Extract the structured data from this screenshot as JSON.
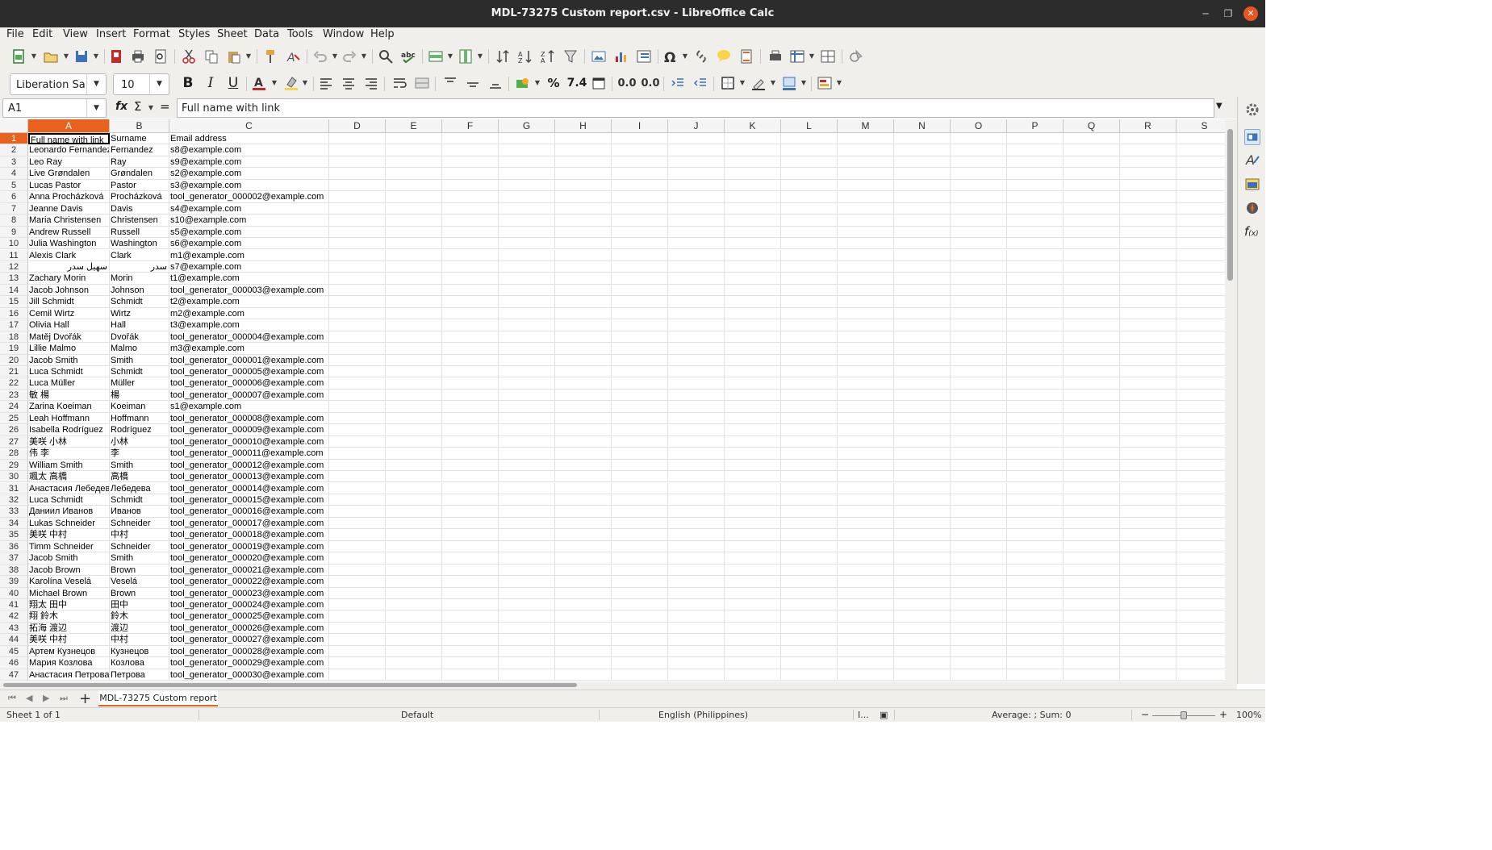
{
  "window": {
    "title": "MDL-73275 Custom report.csv - LibreOffice Calc"
  },
  "menu": [
    "File",
    "Edit",
    "View",
    "Insert",
    "Format",
    "Styles",
    "Sheet",
    "Data",
    "Tools",
    "Window",
    "Help"
  ],
  "toolbar": {
    "font_name": "Liberation Sa",
    "font_size": "10",
    "percent": "%",
    "number_format": "7.4",
    "add_decimal": "0.0",
    "del_decimal": "0.0"
  },
  "formula": {
    "name_box": "A1",
    "fx": "fx",
    "sigma": "Σ",
    "equals": "=",
    "content": "Full name with link"
  },
  "columns": [
    "A",
    "B",
    "C",
    "D",
    "E",
    "F",
    "G",
    "H",
    "I",
    "J",
    "K",
    "L",
    "M",
    "N",
    "O",
    "P",
    "Q",
    "R",
    "S"
  ],
  "rows": [
    [
      "1",
      "Full name with link",
      "Surname",
      "Email address"
    ],
    [
      "2",
      "Leonardo Fernandez",
      "Fernandez",
      "s8@example.com"
    ],
    [
      "3",
      "Leo Ray",
      "Ray",
      "s9@example.com"
    ],
    [
      "4",
      "Live Grøndalen",
      "Grøndalen",
      "s2@example.com"
    ],
    [
      "5",
      "Lucas Pastor",
      "Pastor",
      "s3@example.com"
    ],
    [
      "6",
      "Anna Procházková",
      "Procházková",
      "tool_generator_000002@example.com"
    ],
    [
      "7",
      "Jeanne Davis",
      "Davis",
      "s4@example.com"
    ],
    [
      "8",
      "Maria Christensen",
      "Christensen",
      "s10@example.com"
    ],
    [
      "9",
      "Andrew Russell",
      "Russell",
      "s5@example.com"
    ],
    [
      "10",
      "Julia Washington",
      "Washington",
      "s6@example.com"
    ],
    [
      "11",
      "Alexis Clark",
      "Clark",
      "m1@example.com"
    ],
    [
      "12",
      "سهیل سدر",
      "سدر",
      "s7@example.com"
    ],
    [
      "13",
      "Zachary Morin",
      "Morin",
      "t1@example.com"
    ],
    [
      "14",
      "Jacob Johnson",
      "Johnson",
      "tool_generator_000003@example.com"
    ],
    [
      "15",
      "Jill Schmidt",
      "Schmidt",
      "t2@example.com"
    ],
    [
      "16",
      "Cemil Wirtz",
      "Wirtz",
      "m2@example.com"
    ],
    [
      "17",
      "Olivia Hall",
      "Hall",
      "t3@example.com"
    ],
    [
      "18",
      "Matěj Dvořák",
      "Dvořák",
      "tool_generator_000004@example.com"
    ],
    [
      "19",
      "Lillie Malmo",
      "Malmo",
      "m3@example.com"
    ],
    [
      "20",
      "Jacob Smith",
      "Smith",
      "tool_generator_000001@example.com"
    ],
    [
      "21",
      "Luca Schmidt",
      "Schmidt",
      "tool_generator_000005@example.com"
    ],
    [
      "22",
      "Luca Müller",
      "Müller",
      "tool_generator_000006@example.com"
    ],
    [
      "23",
      "敏 楊",
      "楊",
      "tool_generator_000007@example.com"
    ],
    [
      "24",
      "Zarina Koeiman",
      "Koeiman",
      "s1@example.com"
    ],
    [
      "25",
      "Leah Hoffmann",
      "Hoffmann",
      "tool_generator_000008@example.com"
    ],
    [
      "26",
      "Isabella Rodríguez",
      "Rodríguez",
      "tool_generator_000009@example.com"
    ],
    [
      "27",
      "美咲 小林",
      "小林",
      "tool_generator_000010@example.com"
    ],
    [
      "28",
      "伟 李",
      "李",
      "tool_generator_000011@example.com"
    ],
    [
      "29",
      "William Smith",
      "Smith",
      "tool_generator_000012@example.com"
    ],
    [
      "30",
      "颯太 高橋",
      "高橋",
      "tool_generator_000013@example.com"
    ],
    [
      "31",
      "Анастасия Лебедева",
      "Лебедева",
      "tool_generator_000014@example.com"
    ],
    [
      "32",
      "Luca Schmidt",
      "Schmidt",
      "tool_generator_000015@example.com"
    ],
    [
      "33",
      "Даниил Иванов",
      "Иванов",
      "tool_generator_000016@example.com"
    ],
    [
      "34",
      "Lukas Schneider",
      "Schneider",
      "tool_generator_000017@example.com"
    ],
    [
      "35",
      "美咲 中村",
      "中村",
      "tool_generator_000018@example.com"
    ],
    [
      "36",
      "Timm Schneider",
      "Schneider",
      "tool_generator_000019@example.com"
    ],
    [
      "37",
      "Jacob Smith",
      "Smith",
      "tool_generator_000020@example.com"
    ],
    [
      "38",
      "Jacob Brown",
      "Brown",
      "tool_generator_000021@example.com"
    ],
    [
      "39",
      "Karolína Veselá",
      "Veselá",
      "tool_generator_000022@example.com"
    ],
    [
      "40",
      "Michael Brown",
      "Brown",
      "tool_generator_000023@example.com"
    ],
    [
      "41",
      "翔太 田中",
      "田中",
      "tool_generator_000024@example.com"
    ],
    [
      "42",
      "翔 鈴木",
      "鈴木",
      "tool_generator_000025@example.com"
    ],
    [
      "43",
      "拓海 渡辺",
      "渡辺",
      "tool_generator_000026@example.com"
    ],
    [
      "44",
      "美咲 中村",
      "中村",
      "tool_generator_000027@example.com"
    ],
    [
      "45",
      "Артем Кузнецов",
      "Кузнецов",
      "tool_generator_000028@example.com"
    ],
    [
      "46",
      "Мария Козлова",
      "Козлова",
      "tool_generator_000029@example.com"
    ],
    [
      "47",
      "Анастасия Петрова",
      "Петрова",
      "tool_generator_000030@example.com"
    ]
  ],
  "rtl_rows": [
    "12"
  ],
  "sheet": {
    "tab_name": "MDL-73275 Custom report",
    "add_label": "+"
  },
  "status": {
    "sheet_pos": "Sheet 1 of 1",
    "page_style": "Default",
    "language": "English (Philippines)",
    "selection_mode": "I...",
    "summary": "Average: ; Sum: 0",
    "zoom": "100%",
    "zoom_minus": "−",
    "zoom_plus": "+"
  },
  "colors": {
    "accent": "#e8621e",
    "titlebar": "#2c2c2c",
    "close_button": "#e95420"
  }
}
